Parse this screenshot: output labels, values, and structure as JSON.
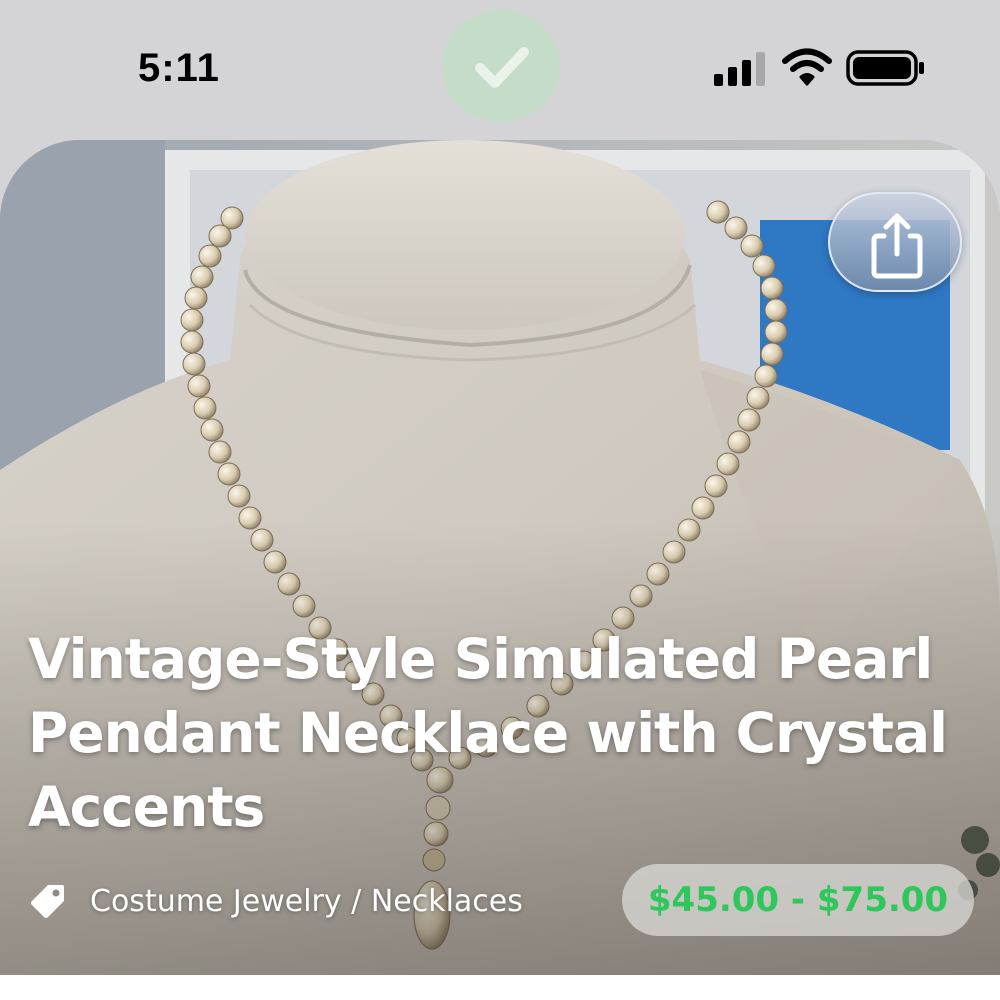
{
  "status_bar": {
    "time": "5:11",
    "icons": [
      "checkmark-icon",
      "cellular-signal-icon",
      "wifi-icon",
      "battery-icon"
    ]
  },
  "product": {
    "title": "Vintage-Style Simulated Pearl Pendant Necklace with Crystal Accents",
    "category": "Costume Jewelry / Necklaces",
    "price_range": "$45.00 - $75.00",
    "image": "pearl-necklace-on-display-bust-photo"
  },
  "actions": {
    "share_icon": "share-icon"
  },
  "colors": {
    "price_green": "#2fc75c",
    "background": "#d4d4d6",
    "title_text": "#ffffff"
  }
}
